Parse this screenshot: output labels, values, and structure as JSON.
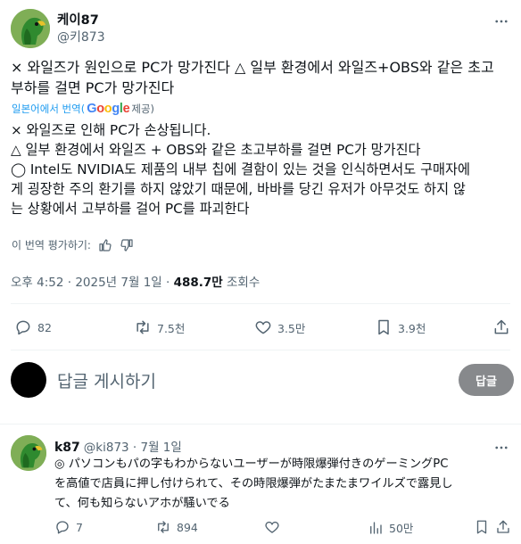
{
  "post": {
    "author": {
      "name": "케이87",
      "handle": "@키873"
    },
    "text": "× 와일즈가 원인으로 PC가 망가진다 △ 일부 환경에서 와일즈+OBS와 같은 초고\n부하를 걸면 PC가 망가진다",
    "translate_label": "일본어에서 번역(",
    "translate_brand": "Google",
    "translate_suffix": " 제공)",
    "translated_text": "× 와일즈로 인해 PC가 손상됩니다.\n△ 일부 환경에서 와일즈 + OBS와 같은 초고부하를 걸면 PC가 망가진다\n◯ Intel도 NVIDIA도 제품의 내부 칩에 결함이 있는 것을 인식하면서도 구매자에\n게 굉장한 주의 환기를 하지 않았기 때문에, 바바를 당긴 유저가 아무것도 하지 않\n는 상황에서 고부하를 걸어 PC를 파괴한다",
    "rate_label": "이 번역 평가하기:",
    "timestamp": "오후 4:52 · 2025년 7월 1일 ·",
    "views_count": "488.7만",
    "views_label": "조회수",
    "stats": {
      "replies": "82",
      "retweets": "7.5천",
      "likes": "3.5만",
      "bookmarks": "3.9천"
    }
  },
  "composer": {
    "placeholder": "답글 게시하기",
    "button_label": "답글"
  },
  "reply": {
    "author": {
      "name": "k87",
      "handle": "@ki873 · 7월 1일"
    },
    "text_lines": [
      "◎ パソコンもパの字もわからないユーザーが時限爆弾付きのゲーミングPC",
      "を高値で店員に押し付けられて、その時限爆弾がたまたまワイルズで露見し",
      "て、何も知らないアホが騒いでる"
    ],
    "stats": {
      "replies": "7",
      "retweets": "894",
      "views": "50만"
    }
  },
  "colors": {
    "accent": "#1d9bf0",
    "muted": "#536471",
    "text": "#0f1419",
    "reply_button": "#87898c"
  }
}
